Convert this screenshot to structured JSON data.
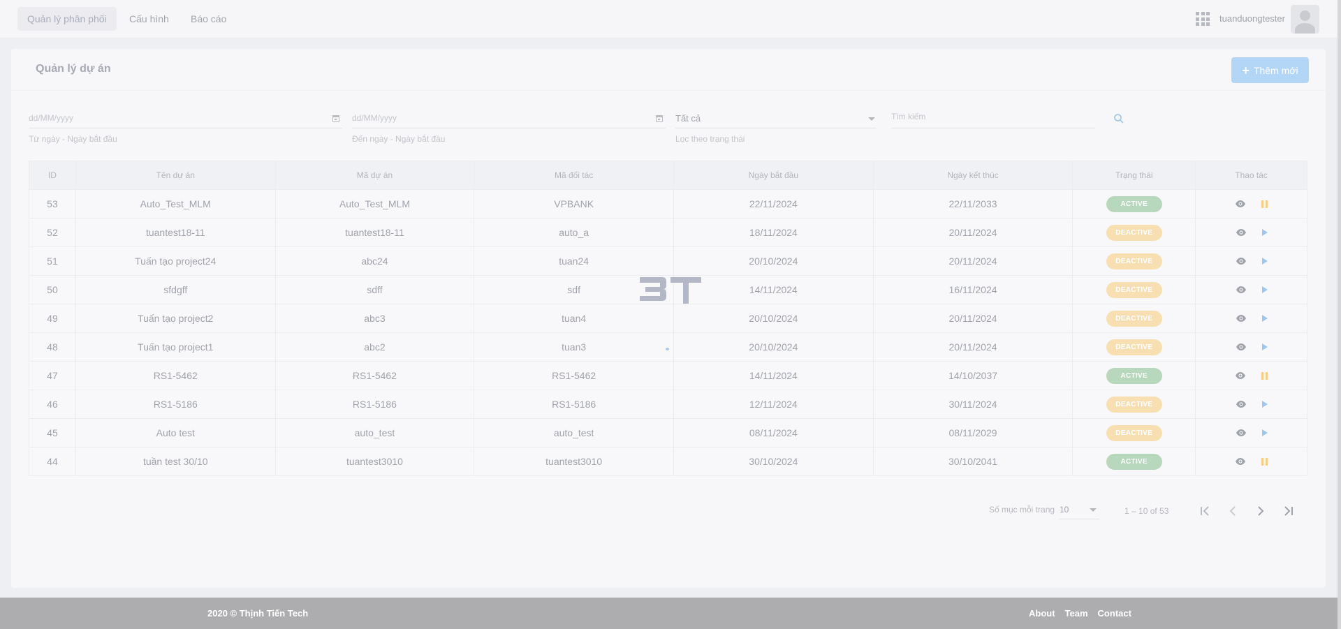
{
  "nav": {
    "items": [
      {
        "label": "Quản lý phân phối",
        "active": true
      },
      {
        "label": "Cấu hình",
        "active": false
      },
      {
        "label": "Báo cáo",
        "active": false
      }
    ],
    "apps_icon": "apps-grid-icon",
    "username": "tuanduongtester",
    "avatar_icon": "user-avatar-icon"
  },
  "page": {
    "title": "Quản lý dự án",
    "add_button": "Thêm mới"
  },
  "filters": {
    "from_date_placeholder": "dd/MM/yyyy",
    "from_date_hint": "Từ ngày - Ngày bắt đầu",
    "to_date_placeholder": "dd/MM/yyyy",
    "to_date_hint": "Đến ngày - Ngày bắt đầu",
    "status_value": "Tất cả",
    "status_hint": "Lọc theo trạng thái",
    "search_placeholder": "Tìm kiếm"
  },
  "table": {
    "headers": {
      "id": "ID",
      "name": "Tên dự án",
      "code": "Mã dự án",
      "partner": "Mã đối tác",
      "start": "Ngày bắt đầu",
      "end": "Ngày kết thúc",
      "status": "Trạng thái",
      "actions": "Thao tác"
    },
    "rows": [
      {
        "id": "53",
        "name": "Auto_Test_MLM",
        "code": "Auto_Test_MLM",
        "partner": "VPBANK",
        "start": "22/11/2024",
        "end": "22/11/2033",
        "status": "ACTIVE"
      },
      {
        "id": "52",
        "name": "tuantest18-11",
        "code": "tuantest18-11",
        "partner": "auto_a",
        "start": "18/11/2024",
        "end": "20/11/2024",
        "status": "DEACTIVE"
      },
      {
        "id": "51",
        "name": "Tuấn tạo project24",
        "code": "abc24",
        "partner": "tuan24",
        "start": "20/10/2024",
        "end": "20/11/2024",
        "status": "DEACTIVE"
      },
      {
        "id": "50",
        "name": "sfdgff",
        "code": "sdff",
        "partner": "sdf",
        "start": "14/11/2024",
        "end": "16/11/2024",
        "status": "DEACTIVE"
      },
      {
        "id": "49",
        "name": "Tuấn tạo project2",
        "code": "abc3",
        "partner": "tuan4",
        "start": "20/10/2024",
        "end": "20/11/2024",
        "status": "DEACTIVE"
      },
      {
        "id": "48",
        "name": "Tuấn tạo project1",
        "code": "abc2",
        "partner": "tuan3",
        "start": "20/10/2024",
        "end": "20/11/2024",
        "status": "DEACTIVE"
      },
      {
        "id": "47",
        "name": "RS1-5462",
        "code": "RS1-5462",
        "partner": "RS1-5462",
        "start": "14/11/2024",
        "end": "14/10/2037",
        "status": "ACTIVE"
      },
      {
        "id": "46",
        "name": "RS1-5186",
        "code": "RS1-5186",
        "partner": "RS1-5186",
        "start": "12/11/2024",
        "end": "30/11/2024",
        "status": "DEACTIVE"
      },
      {
        "id": "45",
        "name": "Auto test",
        "code": "auto_test",
        "partner": "auto_test",
        "start": "08/11/2024",
        "end": "08/11/2029",
        "status": "DEACTIVE"
      },
      {
        "id": "44",
        "name": "tuần test 30/10",
        "code": "tuantest3010",
        "partner": "tuantest3010",
        "start": "30/10/2024",
        "end": "30/10/2041",
        "status": "ACTIVE"
      }
    ]
  },
  "paginator": {
    "per_page_label": "Số mục mỗi trang",
    "per_page_value": "10",
    "range": "1 – 10 of 53"
  },
  "footer": {
    "copyright": "2020 © Thịnh Tiến Tech",
    "links": [
      "About",
      "Team",
      "Contact"
    ]
  },
  "colors": {
    "active_badge": "#b8d8bd",
    "deactive_badge": "#f7dfb2",
    "accent": "#b4d6f6",
    "footer": "#adadaf"
  }
}
